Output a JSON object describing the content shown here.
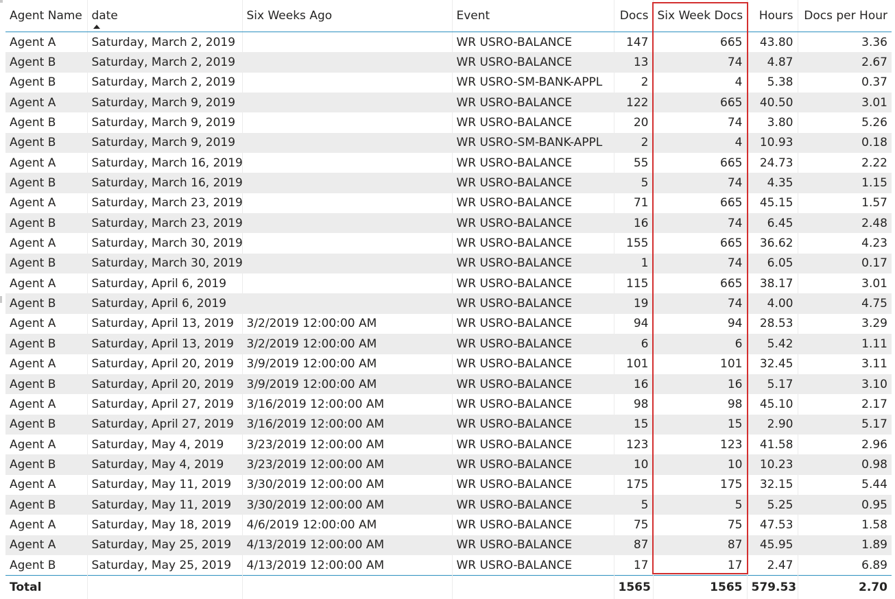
{
  "columns": {
    "agent_name": "Agent Name",
    "date": "date",
    "six_weeks_ago": "Six Weeks Ago",
    "event": "Event",
    "docs": "Docs",
    "six_week_docs": "Six Week Docs",
    "hours": "Hours",
    "docs_per_hour": "Docs per Hour"
  },
  "sort": {
    "column": "date",
    "direction": "ascending"
  },
  "highlight_color": "#d32f2f",
  "rows": [
    {
      "agent": "Agent A",
      "date": "Saturday, March 2, 2019",
      "six_weeks_ago": "",
      "event": "WR USRO-BALANCE",
      "docs": "147",
      "six_week_docs": "665",
      "hours": "43.80",
      "dph": "3.36"
    },
    {
      "agent": "Agent B",
      "date": "Saturday, March 2, 2019",
      "six_weeks_ago": "",
      "event": "WR USRO-BALANCE",
      "docs": "13",
      "six_week_docs": "74",
      "hours": "4.87",
      "dph": "2.67"
    },
    {
      "agent": "Agent B",
      "date": "Saturday, March 2, 2019",
      "six_weeks_ago": "",
      "event": "WR USRO-SM-BANK-APPL",
      "docs": "2",
      "six_week_docs": "4",
      "hours": "5.38",
      "dph": "0.37"
    },
    {
      "agent": "Agent A",
      "date": "Saturday, March 9, 2019",
      "six_weeks_ago": "",
      "event": "WR USRO-BALANCE",
      "docs": "122",
      "six_week_docs": "665",
      "hours": "40.50",
      "dph": "3.01"
    },
    {
      "agent": "Agent B",
      "date": "Saturday, March 9, 2019",
      "six_weeks_ago": "",
      "event": "WR USRO-BALANCE",
      "docs": "20",
      "six_week_docs": "74",
      "hours": "3.80",
      "dph": "5.26"
    },
    {
      "agent": "Agent B",
      "date": "Saturday, March 9, 2019",
      "six_weeks_ago": "",
      "event": "WR USRO-SM-BANK-APPL",
      "docs": "2",
      "six_week_docs": "4",
      "hours": "10.93",
      "dph": "0.18"
    },
    {
      "agent": "Agent A",
      "date": "Saturday, March 16, 2019",
      "six_weeks_ago": "",
      "event": "WR USRO-BALANCE",
      "docs": "55",
      "six_week_docs": "665",
      "hours": "24.73",
      "dph": "2.22"
    },
    {
      "agent": "Agent B",
      "date": "Saturday, March 16, 2019",
      "six_weeks_ago": "",
      "event": "WR USRO-BALANCE",
      "docs": "5",
      "six_week_docs": "74",
      "hours": "4.35",
      "dph": "1.15"
    },
    {
      "agent": "Agent A",
      "date": "Saturday, March 23, 2019",
      "six_weeks_ago": "",
      "event": "WR USRO-BALANCE",
      "docs": "71",
      "six_week_docs": "665",
      "hours": "45.15",
      "dph": "1.57"
    },
    {
      "agent": "Agent B",
      "date": "Saturday, March 23, 2019",
      "six_weeks_ago": "",
      "event": "WR USRO-BALANCE",
      "docs": "16",
      "six_week_docs": "74",
      "hours": "6.45",
      "dph": "2.48"
    },
    {
      "agent": "Agent A",
      "date": "Saturday, March 30, 2019",
      "six_weeks_ago": "",
      "event": "WR USRO-BALANCE",
      "docs": "155",
      "six_week_docs": "665",
      "hours": "36.62",
      "dph": "4.23"
    },
    {
      "agent": "Agent B",
      "date": "Saturday, March 30, 2019",
      "six_weeks_ago": "",
      "event": "WR USRO-BALANCE",
      "docs": "1",
      "six_week_docs": "74",
      "hours": "6.05",
      "dph": "0.17"
    },
    {
      "agent": "Agent A",
      "date": "Saturday, April 6, 2019",
      "six_weeks_ago": "",
      "event": "WR USRO-BALANCE",
      "docs": "115",
      "six_week_docs": "665",
      "hours": "38.17",
      "dph": "3.01"
    },
    {
      "agent": "Agent B",
      "date": "Saturday, April 6, 2019",
      "six_weeks_ago": "",
      "event": "WR USRO-BALANCE",
      "docs": "19",
      "six_week_docs": "74",
      "hours": "4.00",
      "dph": "4.75"
    },
    {
      "agent": "Agent A",
      "date": "Saturday, April 13, 2019",
      "six_weeks_ago": "3/2/2019 12:00:00 AM",
      "event": "WR USRO-BALANCE",
      "docs": "94",
      "six_week_docs": "94",
      "hours": "28.53",
      "dph": "3.29"
    },
    {
      "agent": "Agent B",
      "date": "Saturday, April 13, 2019",
      "six_weeks_ago": "3/2/2019 12:00:00 AM",
      "event": "WR USRO-BALANCE",
      "docs": "6",
      "six_week_docs": "6",
      "hours": "5.42",
      "dph": "1.11"
    },
    {
      "agent": "Agent A",
      "date": "Saturday, April 20, 2019",
      "six_weeks_ago": "3/9/2019 12:00:00 AM",
      "event": "WR USRO-BALANCE",
      "docs": "101",
      "six_week_docs": "101",
      "hours": "32.45",
      "dph": "3.11"
    },
    {
      "agent": "Agent B",
      "date": "Saturday, April 20, 2019",
      "six_weeks_ago": "3/9/2019 12:00:00 AM",
      "event": "WR USRO-BALANCE",
      "docs": "16",
      "six_week_docs": "16",
      "hours": "5.17",
      "dph": "3.10"
    },
    {
      "agent": "Agent A",
      "date": "Saturday, April 27, 2019",
      "six_weeks_ago": "3/16/2019 12:00:00 AM",
      "event": "WR USRO-BALANCE",
      "docs": "98",
      "six_week_docs": "98",
      "hours": "45.10",
      "dph": "2.17"
    },
    {
      "agent": "Agent B",
      "date": "Saturday, April 27, 2019",
      "six_weeks_ago": "3/16/2019 12:00:00 AM",
      "event": "WR USRO-BALANCE",
      "docs": "15",
      "six_week_docs": "15",
      "hours": "2.90",
      "dph": "5.17"
    },
    {
      "agent": "Agent A",
      "date": "Saturday, May 4, 2019",
      "six_weeks_ago": "3/23/2019 12:00:00 AM",
      "event": "WR USRO-BALANCE",
      "docs": "123",
      "six_week_docs": "123",
      "hours": "41.58",
      "dph": "2.96"
    },
    {
      "agent": "Agent B",
      "date": "Saturday, May 4, 2019",
      "six_weeks_ago": "3/23/2019 12:00:00 AM",
      "event": "WR USRO-BALANCE",
      "docs": "10",
      "six_week_docs": "10",
      "hours": "10.23",
      "dph": "0.98"
    },
    {
      "agent": "Agent A",
      "date": "Saturday, May 11, 2019",
      "six_weeks_ago": "3/30/2019 12:00:00 AM",
      "event": "WR USRO-BALANCE",
      "docs": "175",
      "six_week_docs": "175",
      "hours": "32.15",
      "dph": "5.44"
    },
    {
      "agent": "Agent B",
      "date": "Saturday, May 11, 2019",
      "six_weeks_ago": "3/30/2019 12:00:00 AM",
      "event": "WR USRO-BALANCE",
      "docs": "5",
      "six_week_docs": "5",
      "hours": "5.25",
      "dph": "0.95"
    },
    {
      "agent": "Agent A",
      "date": "Saturday, May 18, 2019",
      "six_weeks_ago": "4/6/2019 12:00:00 AM",
      "event": "WR USRO-BALANCE",
      "docs": "75",
      "six_week_docs": "75",
      "hours": "47.53",
      "dph": "1.58"
    },
    {
      "agent": "Agent A",
      "date": "Saturday, May 25, 2019",
      "six_weeks_ago": "4/13/2019 12:00:00 AM",
      "event": "WR USRO-BALANCE",
      "docs": "87",
      "six_week_docs": "87",
      "hours": "45.95",
      "dph": "1.89"
    },
    {
      "agent": "Agent B",
      "date": "Saturday, May 25, 2019",
      "six_weeks_ago": "4/13/2019 12:00:00 AM",
      "event": "WR USRO-BALANCE",
      "docs": "17",
      "six_week_docs": "17",
      "hours": "2.47",
      "dph": "6.89"
    }
  ],
  "total": {
    "label": "Total",
    "docs": "1565",
    "six_week_docs": "1565",
    "hours": "579.53",
    "dph": "2.70"
  }
}
